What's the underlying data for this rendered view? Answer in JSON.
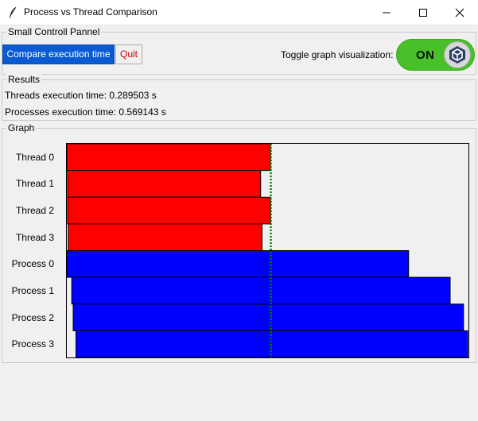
{
  "window": {
    "title": "Process vs Thread Comparison"
  },
  "controls": {
    "legend": "Small Controll Pannel",
    "compare_label": "Compare execution time",
    "quit_label": "Quit",
    "toggle_label": "Toggle graph visualization:",
    "toggle_state": "ON"
  },
  "results": {
    "legend": "Results",
    "threads_line": "Threads execution time: 0.289503 s",
    "processes_line": "Processes execution time: 0.569143 s"
  },
  "graph": {
    "legend": "Graph"
  },
  "colors": {
    "thread": "#ff0000",
    "process": "#0000ff",
    "marker": "#008000",
    "compare_button": "#0a5bd3",
    "toggle_on": "#48c02a"
  },
  "chart_data": {
    "type": "bar",
    "orientation": "horizontal",
    "categories": [
      "Thread 0",
      "Thread 1",
      "Thread 2",
      "Thread 3",
      "Process 0",
      "Process 1",
      "Process 2",
      "Process 3"
    ],
    "series": [
      {
        "kind": "thread",
        "start": [
          0.0,
          0.001,
          0.001,
          0.002
        ],
        "end": [
          0.289,
          0.275,
          0.289,
          0.277
        ]
      },
      {
        "kind": "process",
        "start": [
          0.0,
          0.007,
          0.009,
          0.013
        ],
        "end": [
          0.485,
          0.544,
          0.563,
          0.569
        ]
      }
    ],
    "marker_x": 0.2895,
    "xlim": [
      0,
      0.57
    ],
    "grid": false,
    "legend": "none"
  }
}
